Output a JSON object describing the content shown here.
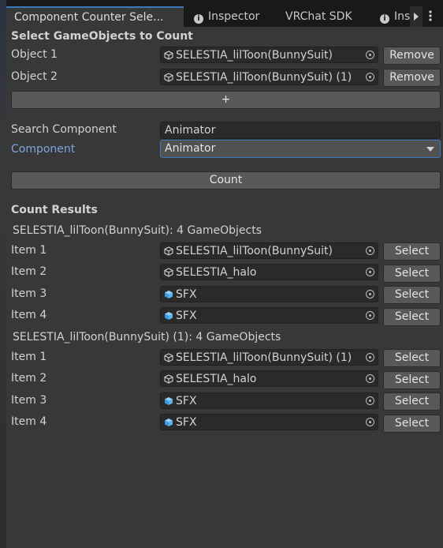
{
  "tabs": [
    {
      "label": "Component Counter Sele...",
      "active": true
    },
    {
      "label": "Inspector",
      "icon": "info-icon"
    },
    {
      "label": "VRChat SDK"
    },
    {
      "label": "Ins",
      "icon": "info-icon"
    }
  ],
  "select_section": {
    "heading": "Select GameObjects to Count",
    "objects": [
      {
        "label": "Object 1",
        "value": "SELESTIA_lilToon(BunnySuit)",
        "button": "Remove",
        "icon": "gameobject-icon"
      },
      {
        "label": "Object 2",
        "value": "SELESTIA_lilToon(BunnySuit) (1)",
        "button": "Remove",
        "icon": "gameobject-icon"
      }
    ],
    "add_label": "+"
  },
  "search": {
    "label": "Search Component",
    "value": "Animator"
  },
  "component": {
    "label": "Component",
    "value": "Animator"
  },
  "count_button": "Count",
  "results": {
    "heading": "Count Results",
    "groups": [
      {
        "title": "SELESTIA_lilToon(BunnySuit): 4 GameObjects",
        "items": [
          {
            "label": "Item 1",
            "value": "SELESTIA_lilToon(BunnySuit)",
            "icon": "gameobject-icon",
            "button": "Select"
          },
          {
            "label": "Item 2",
            "value": "SELESTIA_halo",
            "icon": "gameobject-icon",
            "button": "Select"
          },
          {
            "label": "Item 3",
            "value": "SFX",
            "icon": "prefab-icon",
            "button": "Select"
          },
          {
            "label": "Item 4",
            "value": "SFX",
            "icon": "prefab-icon",
            "button": "Select"
          }
        ]
      },
      {
        "title": "SELESTIA_lilToon(BunnySuit) (1): 4 GameObjects",
        "items": [
          {
            "label": "Item 1",
            "value": "SELESTIA_lilToon(BunnySuit) (1)",
            "icon": "gameobject-icon",
            "button": "Select"
          },
          {
            "label": "Item 2",
            "value": "SELESTIA_halo",
            "icon": "gameobject-icon",
            "button": "Select"
          },
          {
            "label": "Item 3",
            "value": "SFX",
            "icon": "prefab-icon",
            "button": "Select"
          },
          {
            "label": "Item 4",
            "value": "SFX",
            "icon": "prefab-icon",
            "button": "Select"
          }
        ]
      }
    ]
  },
  "colors": {
    "accent": "#3a79bb",
    "component_label": "#7fa6e0",
    "panel": "#383838",
    "field": "#2a2a2a",
    "button": "#585858",
    "prefab_icon": "#5bb3f0"
  }
}
